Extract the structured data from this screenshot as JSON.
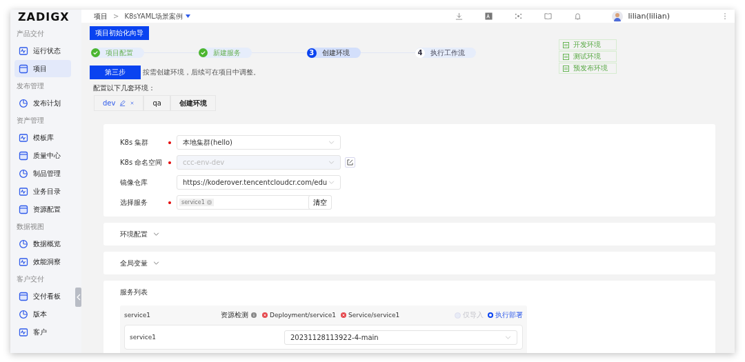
{
  "sidebar": {
    "logo": "ZADIGX",
    "groups": [
      {
        "title": "产品交付",
        "items": [
          {
            "label": "运行状态",
            "selected": false
          },
          {
            "label": "项目",
            "selected": true
          }
        ]
      },
      {
        "title": "发布管理",
        "items": [
          {
            "label": "发布计划",
            "selected": false
          }
        ]
      },
      {
        "title": "资产管理",
        "items": [
          {
            "label": "模板库",
            "selected": false
          },
          {
            "label": "质量中心",
            "selected": false
          },
          {
            "label": "制品管理",
            "selected": false
          },
          {
            "label": "业务目录",
            "selected": false
          },
          {
            "label": "资源配置",
            "selected": false
          }
        ]
      },
      {
        "title": "数据视图",
        "items": [
          {
            "label": "数据概览",
            "selected": false
          },
          {
            "label": "效能洞察",
            "selected": false
          }
        ]
      },
      {
        "title": "客户交付",
        "items": [
          {
            "label": "交付看板",
            "selected": false
          },
          {
            "label": "版本",
            "selected": false
          },
          {
            "label": "客户",
            "selected": false
          }
        ]
      }
    ]
  },
  "breadcrumb": {
    "root": "项目",
    "separator": ">",
    "project": "K8sYAML场景案例"
  },
  "user": {
    "name": "lilian(lilian)"
  },
  "wizard": {
    "title": "项目初始化向导",
    "steps": [
      {
        "label": "项目配置",
        "completed": true,
        "selected": false
      },
      {
        "label": "新建服务",
        "completed": true,
        "selected": false
      },
      {
        "number": "3",
        "label": "创建环境",
        "completed": false,
        "selected": true
      },
      {
        "number": "4",
        "label": "执行工作流",
        "completed": false,
        "selected": false
      }
    ],
    "env_tags": [
      "开发环境",
      "测试环境",
      "预发布环境"
    ],
    "step_badge": "第三步",
    "step_hint": "按需创建环境，后续可在项目中调整。",
    "env_prompt": "配置以下几套环境："
  },
  "env_tabs": [
    {
      "label": "dev",
      "kind": "env",
      "selected": true
    },
    {
      "label": "qa",
      "kind": "env",
      "selected": false
    },
    {
      "label": "创建环境",
      "kind": "add",
      "selected": false
    }
  ],
  "form": [
    {
      "label": "K8s 集群",
      "required": true,
      "kind": "select",
      "value": "本地集群(hello)",
      "disabled": false
    },
    {
      "label": "K8s 命名空间",
      "required": true,
      "kind": "select",
      "value": "ccc-env-dev",
      "disabled": true,
      "editable": true
    },
    {
      "label": "镜像仓库",
      "required": false,
      "kind": "select",
      "value": "https://koderover.tencentcloudcr.com/edu",
      "disabled": false
    },
    {
      "label": "选择服务",
      "required": true,
      "kind": "tags",
      "tags": [
        "service1"
      ],
      "button": "清空",
      "disabled": false
    }
  ],
  "sections": [
    {
      "title": "环境配置",
      "expanded": false
    },
    {
      "title": "全局变量",
      "expanded": false
    }
  ],
  "service_list": {
    "title": "服务列表",
    "services": [
      {
        "name": "service1",
        "check_label": "资源检测",
        "resources": [
          "Deployment/service1",
          "Service/service1"
        ],
        "options": [
          {
            "label": "仅导入",
            "selected": false,
            "disabled": true
          },
          {
            "label": "执行部署",
            "selected": true,
            "disabled": false
          }
        ],
        "inner": {
          "name": "service1",
          "version": "20231128113922-4-main"
        }
      }
    ]
  }
}
